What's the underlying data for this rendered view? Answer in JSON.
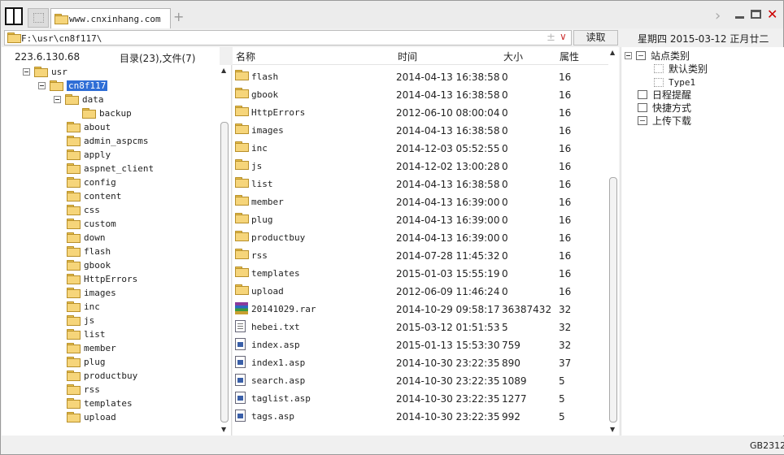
{
  "window": {
    "tab_title": "www.cnxinhang.com",
    "new_tab_symbol": "+",
    "forward_symbol": "›",
    "close_symbol": "✕"
  },
  "address": {
    "path": "F:\\usr\\cn8f117\\",
    "plus_symbol": "±",
    "dropdown_symbol": "∨",
    "read_button": "读取",
    "date_line": "星期四 2015-03-12 正月廿二"
  },
  "left_header": {
    "server_ip": "223.6.130.68",
    "summary": "目录(23),文件(7)"
  },
  "tree": {
    "root": "usr",
    "selected": "cn8f117",
    "data": "data",
    "backup": "backup",
    "items": [
      "about",
      "admin_aspcms",
      "apply",
      "aspnet_client",
      "config",
      "content",
      "css",
      "custom",
      "down",
      "flash",
      "gbook",
      "HttpErrors",
      "images",
      "inc",
      "js",
      "list",
      "member",
      "plug",
      "productbuy",
      "rss",
      "templates",
      "upload"
    ]
  },
  "list": {
    "headers": {
      "name": "名称",
      "time": "时间",
      "size": "大小",
      "attr": "属性"
    },
    "rows": [
      {
        "name": "flash",
        "time": "2014-04-13 16:38:58",
        "size": "0",
        "attr": "16",
        "type": "folder"
      },
      {
        "name": "gbook",
        "time": "2014-04-13 16:38:58",
        "size": "0",
        "attr": "16",
        "type": "folder"
      },
      {
        "name": "HttpErrors",
        "time": "2012-06-10 08:00:04",
        "size": "0",
        "attr": "16",
        "type": "folder"
      },
      {
        "name": "images",
        "time": "2014-04-13 16:38:58",
        "size": "0",
        "attr": "16",
        "type": "folder"
      },
      {
        "name": "inc",
        "time": "2014-12-03 05:52:55",
        "size": "0",
        "attr": "16",
        "type": "folder"
      },
      {
        "name": "js",
        "time": "2014-12-02 13:00:28",
        "size": "0",
        "attr": "16",
        "type": "folder"
      },
      {
        "name": "list",
        "time": "2014-04-13 16:38:58",
        "size": "0",
        "attr": "16",
        "type": "folder"
      },
      {
        "name": "member",
        "time": "2014-04-13 16:39:00",
        "size": "0",
        "attr": "16",
        "type": "folder"
      },
      {
        "name": "plug",
        "time": "2014-04-13 16:39:00",
        "size": "0",
        "attr": "16",
        "type": "folder"
      },
      {
        "name": "productbuy",
        "time": "2014-04-13 16:39:00",
        "size": "0",
        "attr": "16",
        "type": "folder"
      },
      {
        "name": "rss",
        "time": "2014-07-28 11:45:32",
        "size": "0",
        "attr": "16",
        "type": "folder"
      },
      {
        "name": "templates",
        "time": "2015-01-03 15:55:19",
        "size": "0",
        "attr": "16",
        "type": "folder"
      },
      {
        "name": "upload",
        "time": "2012-06-09 11:46:24",
        "size": "0",
        "attr": "16",
        "type": "folder"
      },
      {
        "name": "20141029.rar",
        "time": "2014-10-29 09:58:17",
        "size": "36387432",
        "attr": "32",
        "type": "rar"
      },
      {
        "name": "hebei.txt",
        "time": "2015-03-12 01:51:53",
        "size": "5",
        "attr": "32",
        "type": "txt"
      },
      {
        "name": "index.asp",
        "time": "2015-01-13 15:53:30",
        "size": "759",
        "attr": "32",
        "type": "asp"
      },
      {
        "name": "index1.asp",
        "time": "2014-10-30 23:22:35",
        "size": "890",
        "attr": "37",
        "type": "asp"
      },
      {
        "name": "search.asp",
        "time": "2014-10-30 23:22:35",
        "size": "1089",
        "attr": "5",
        "type": "asp"
      },
      {
        "name": "taglist.asp",
        "time": "2014-10-30 23:22:35",
        "size": "1277",
        "attr": "5",
        "type": "asp"
      },
      {
        "name": "tags.asp",
        "time": "2014-10-30 23:22:35",
        "size": "992",
        "attr": "5",
        "type": "asp"
      }
    ]
  },
  "right_tree": {
    "site_category": "站点类别",
    "default_category": "默认类别",
    "type1": "Type1",
    "schedule": "日程提醒",
    "shortcut": "快捷方式",
    "upload_download": "上传下载"
  },
  "status": {
    "encoding": "GB2312"
  }
}
